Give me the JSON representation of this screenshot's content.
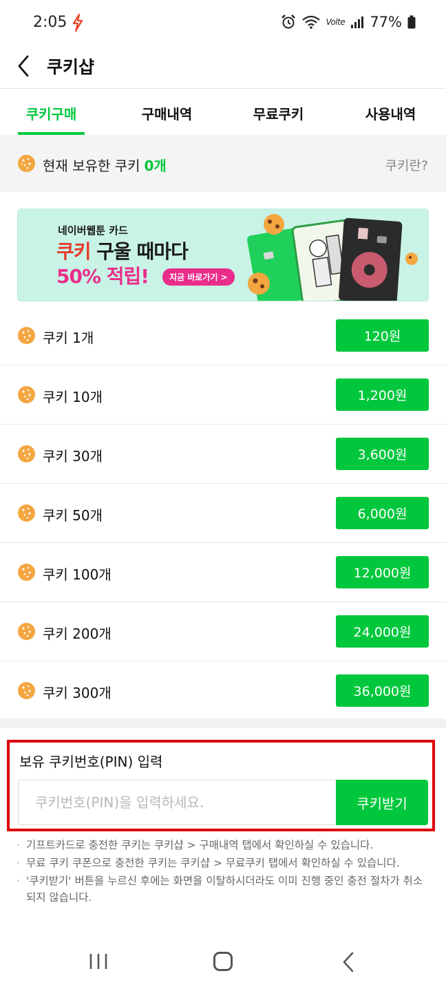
{
  "status_bar": {
    "time": "2:05",
    "battery": "77%",
    "network": "Volte"
  },
  "header": {
    "title": "쿠키샵"
  },
  "tabs": [
    {
      "label": "쿠키구매",
      "active": true
    },
    {
      "label": "구매내역",
      "active": false
    },
    {
      "label": "무료쿠키",
      "active": false
    },
    {
      "label": "사용내역",
      "active": false
    }
  ],
  "balance": {
    "label": "현재 보유한 쿠키",
    "count": "0개",
    "help_link": "쿠키란?"
  },
  "banner": {
    "line1": "네이버웹툰 카드",
    "line2_highlight": "쿠키",
    "line2_rest": " 구울 때마다",
    "line3": "50% 적립!",
    "cta": "지금 바로가기 >"
  },
  "products": [
    {
      "label": "쿠키 1개",
      "price": "120원"
    },
    {
      "label": "쿠키 10개",
      "price": "1,200원"
    },
    {
      "label": "쿠키 30개",
      "price": "3,600원"
    },
    {
      "label": "쿠키 50개",
      "price": "6,000원"
    },
    {
      "label": "쿠키 100개",
      "price": "12,000원"
    },
    {
      "label": "쿠키 200개",
      "price": "24,000원"
    },
    {
      "label": "쿠키 300개",
      "price": "36,000원"
    }
  ],
  "pin": {
    "title": "보유 쿠키번호(PIN) 입력",
    "placeholder": "쿠키번호(PIN)을 입력하세요.",
    "value": "",
    "button": "쿠키받기"
  },
  "notes": [
    "기프트카드로 충전한 쿠키는 쿠키샵 > 구매내역 탭에서 확인하실 수 있습니다.",
    "무료 쿠키 쿠폰으로 충전한 쿠키는 쿠키샵 > 무료쿠키 탭에서 확인하실 수 있습니다.",
    "'쿠키받기' 버튼을 누르신 후에는 화면을 이탈하시더라도 이미 진행 중인 충전 절차가 취소되지 않습니다."
  ],
  "colors": {
    "accent": "#00c73c",
    "highlight_border": "#e0000b",
    "cookie": "#f4a640"
  }
}
